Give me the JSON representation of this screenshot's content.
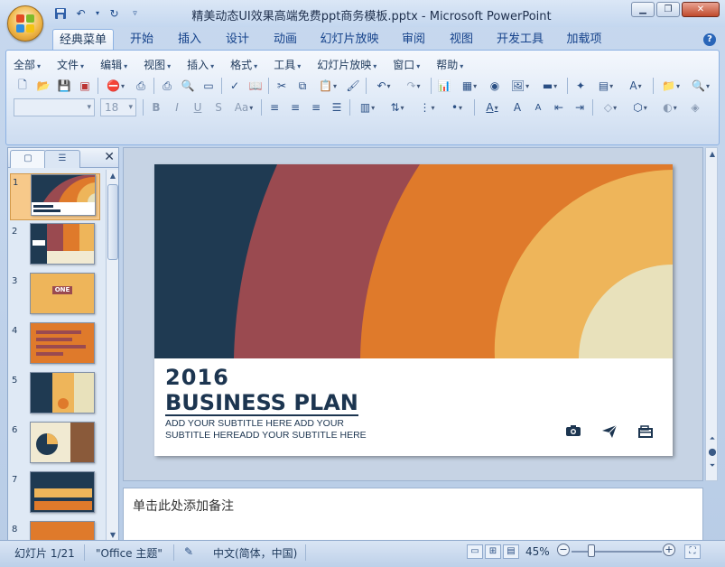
{
  "window": {
    "title": "精美动态UI效果高端免费ppt商务模板.pptx - Microsoft PowerPoint",
    "controls": [
      "minimize",
      "restore",
      "close"
    ]
  },
  "quick_access": [
    "save-icon",
    "undo-icon",
    "dropdown-icon",
    "redo-icon",
    "customize-icon"
  ],
  "tabs": [
    {
      "label": "经典菜单",
      "active": true
    },
    {
      "label": "开始"
    },
    {
      "label": "插入"
    },
    {
      "label": "设计"
    },
    {
      "label": "动画"
    },
    {
      "label": "幻灯片放映"
    },
    {
      "label": "审阅"
    },
    {
      "label": "视图"
    },
    {
      "label": "开发工具"
    },
    {
      "label": "加载项"
    }
  ],
  "menus": [
    "全部",
    "文件",
    "编辑",
    "视图",
    "插入",
    "格式",
    "工具",
    "幻灯片放映",
    "窗口",
    "帮助"
  ],
  "format_bar": {
    "font_name": "",
    "font_size": "18"
  },
  "slide_pane": {
    "thumbnails": [
      {
        "num": "1",
        "selected": true
      },
      {
        "num": "2"
      },
      {
        "num": "3",
        "label": "ONE"
      },
      {
        "num": "4"
      },
      {
        "num": "5"
      },
      {
        "num": "6"
      },
      {
        "num": "7"
      },
      {
        "num": "8"
      }
    ]
  },
  "slide": {
    "year": "2016",
    "title": "BUSINESS PLAN",
    "subtitle": "ADD YOUR SUBTITLE  HERE ADD YOUR SUBTITLE HEREADD YOUR SUBTITLE HERE",
    "icons": [
      "camera-icon",
      "send-icon",
      "briefcase-icon"
    ],
    "colors": {
      "navy": "#1f3a52",
      "maroon": "#9a4a50",
      "orange": "#df7a2b",
      "gold": "#eeb55a",
      "cream": "#e8e1bb"
    }
  },
  "notes": {
    "placeholder": "单击此处添加备注"
  },
  "status_bar": {
    "slide_info": "幻灯片 1/21",
    "theme": "\"Office 主题\"",
    "language": "中文(简体，中国)",
    "zoom": "45%"
  }
}
